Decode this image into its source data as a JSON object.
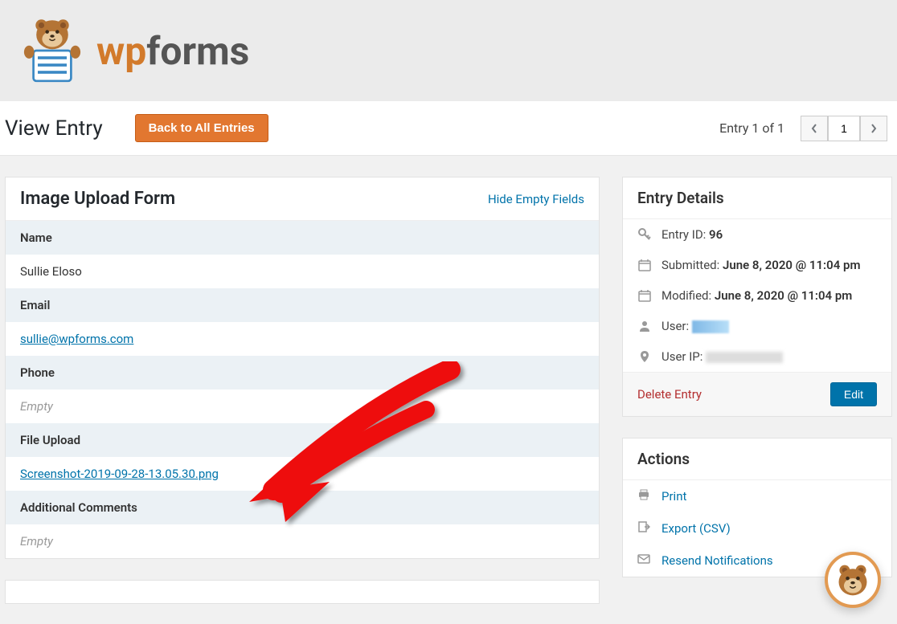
{
  "brand": {
    "wp": "wp",
    "forms": "forms"
  },
  "page": {
    "title": "View Entry",
    "back_label": "Back to All Entries",
    "entry_count": "Entry 1 of 1",
    "page_input": "1"
  },
  "form": {
    "title": "Image Upload Form",
    "hide_empty_label": "Hide Empty Fields",
    "fields": {
      "name_label": "Name",
      "name_value": "Sullie Eloso",
      "email_label": "Email",
      "email_value": "sullie@wpforms.com",
      "phone_label": "Phone",
      "phone_value": "Empty",
      "file_label": "File Upload",
      "file_value": "Screenshot-2019-09-28-13.05.30.png",
      "comments_label": "Additional Comments",
      "comments_value": "Empty"
    }
  },
  "details": {
    "title": "Entry Details",
    "entry_id_label": "Entry ID:",
    "entry_id_value": "96",
    "submitted_label": "Submitted:",
    "submitted_value": "June 8, 2020 @ 11:04 pm",
    "modified_label": "Modified:",
    "modified_value": "June 8, 2020 @ 11:04 pm",
    "user_label": "User:",
    "user_ip_label": "User IP:",
    "delete_label": "Delete Entry",
    "edit_label": "Edit"
  },
  "actions": {
    "title": "Actions",
    "print": "Print",
    "export": "Export (CSV)",
    "resend": "Resend Notifications"
  }
}
